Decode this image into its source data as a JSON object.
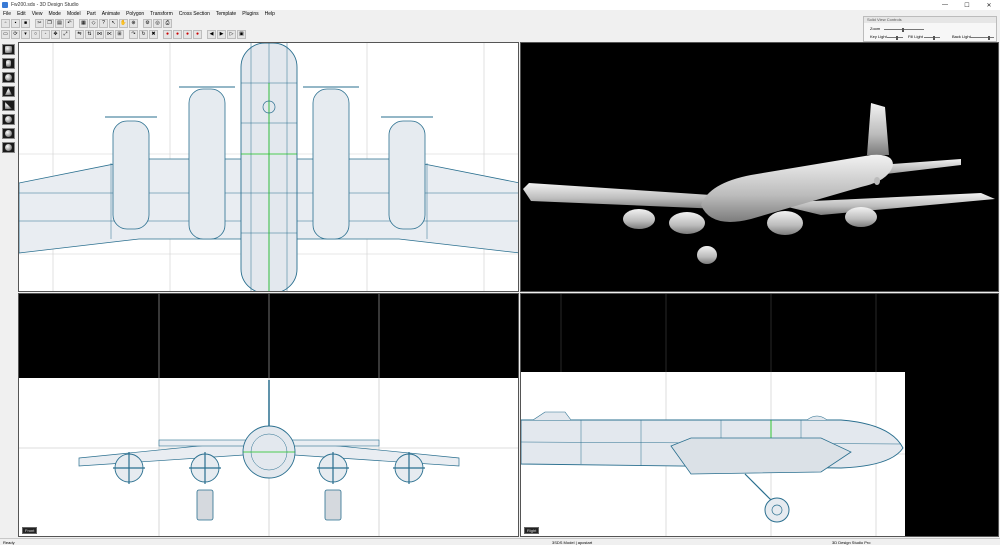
{
  "window": {
    "title": "Fw200.sds - 3D Design Studio",
    "minimize": "—",
    "maximize": "☐",
    "close": "✕"
  },
  "menu": [
    "File",
    "Edit",
    "View",
    "Mode",
    "Model",
    "Part",
    "Animate",
    "Polygon",
    "Transform",
    "Cross Section",
    "Template",
    "Plugins",
    "Help"
  ],
  "solid_view_controls": {
    "title": "Solid View Controls",
    "zoom_label": "Zoom",
    "key_light_label": "Key Light",
    "fill_light_label": "Fill Light",
    "back_light_label": "Back Light",
    "zoom_value": 0.45,
    "key_light_value": 0.55,
    "fill_light_value": 0.55,
    "back_light_value": 0.75
  },
  "viewports": {
    "bottom_left_label": "Front",
    "bottom_right_label": "Right"
  },
  "status": {
    "left": "Ready",
    "middle": "3SDS Model | apostart",
    "right": "3D Design Studio Pro"
  },
  "colors": {
    "wire": "#2a6f8f",
    "highlight": "#1cc21c",
    "bg_dark": "#000000",
    "panel": "#f0f0f0"
  }
}
